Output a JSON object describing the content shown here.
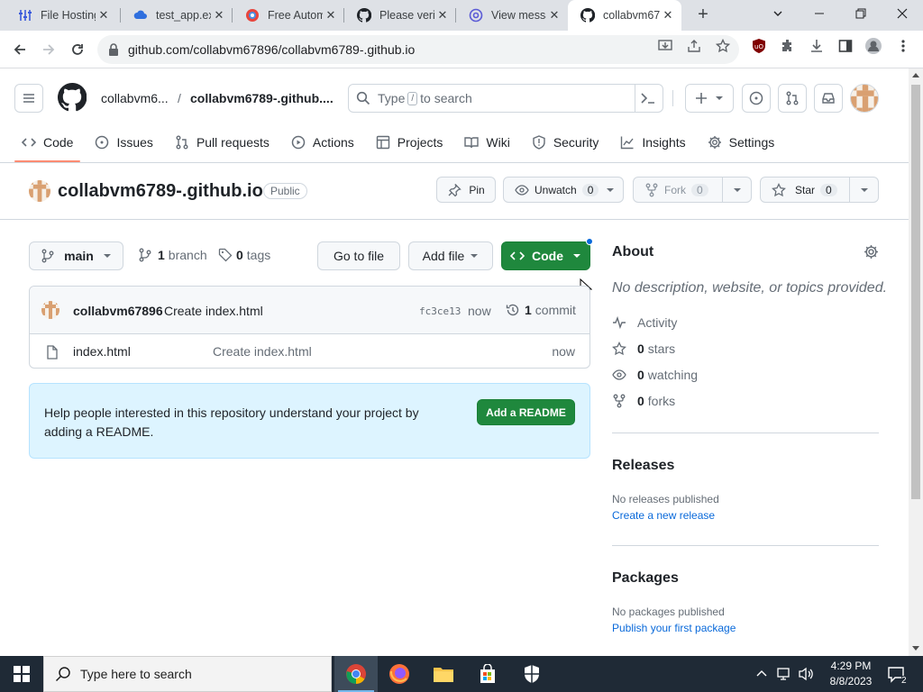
{
  "browser": {
    "tabs": [
      {
        "title": "File Hosting",
        "icon": "sliders-icon"
      },
      {
        "title": "test_app.exe",
        "icon": "cloud-icon"
      },
      {
        "title": "Free Autom",
        "icon": "globe-icon"
      },
      {
        "title": "Please verif",
        "icon": "github-icon"
      },
      {
        "title": "View messa",
        "icon": "at-icon"
      },
      {
        "title": "collabvm67",
        "icon": "github-icon"
      }
    ],
    "active_tab": 5,
    "url": "github.com/collabvm67896/collabvm6789-.github.io"
  },
  "header": {
    "owner_crumb": "collabvm6...",
    "separator": "/",
    "repo_crumb": "collabvm6789-.github....",
    "search_placeholder_pre": "Type",
    "search_key": "/",
    "search_placeholder_post": "to search"
  },
  "repo_nav": [
    {
      "label": "Code",
      "icon": "code-icon",
      "active": true
    },
    {
      "label": "Issues",
      "icon": "issue-icon"
    },
    {
      "label": "Pull requests",
      "icon": "pull-request-icon"
    },
    {
      "label": "Actions",
      "icon": "play-icon"
    },
    {
      "label": "Projects",
      "icon": "table-icon"
    },
    {
      "label": "Wiki",
      "icon": "book-icon"
    },
    {
      "label": "Security",
      "icon": "shield-icon"
    },
    {
      "label": "Insights",
      "icon": "graph-icon"
    },
    {
      "label": "Settings",
      "icon": "gear-icon"
    }
  ],
  "repo": {
    "name": "collabvm6789-.github.io",
    "visibility": "Public",
    "pin_label": "Pin",
    "unwatch_label": "Unwatch",
    "unwatch_count": "0",
    "fork_label": "Fork",
    "fork_count": "0",
    "star_label": "Star",
    "star_count": "0"
  },
  "toolbar": {
    "branch": "main",
    "branch_count": "1",
    "branch_label": "branch",
    "tag_count": "0",
    "tag_label": "tags",
    "go_to_file": "Go to file",
    "add_file": "Add file",
    "code_button": "Code"
  },
  "commit": {
    "author": "collabvm67896",
    "message": "Create index.html",
    "sha": "fc3ce13",
    "time": "now",
    "commit_count": "1",
    "commit_label": "commit"
  },
  "files": [
    {
      "name": "index.html",
      "message": "Create index.html",
      "time": "now"
    }
  ],
  "readme_banner": {
    "text_line1": "Help people interested in this repository understand your project by",
    "text_line2": "adding a README.",
    "button": "Add a README"
  },
  "about": {
    "heading": "About",
    "description": "No description, website, or topics provided.",
    "activity": "Activity",
    "stars_count": "0",
    "stars_label": "stars",
    "watching_count": "0",
    "watching_label": "watching",
    "forks_count": "0",
    "forks_label": "forks"
  },
  "releases": {
    "heading": "Releases",
    "empty": "No releases published",
    "link": "Create a new release"
  },
  "packages": {
    "heading": "Packages",
    "empty": "No packages published",
    "link": "Publish your first package"
  },
  "taskbar": {
    "search_placeholder": "Type here to search",
    "time": "4:29 PM",
    "date": "8/8/2023"
  },
  "colors": {
    "green": "#1f883d",
    "accent_underline": "#fd8c73",
    "link": "#0969da",
    "readme_bg": "#ddf4ff"
  }
}
